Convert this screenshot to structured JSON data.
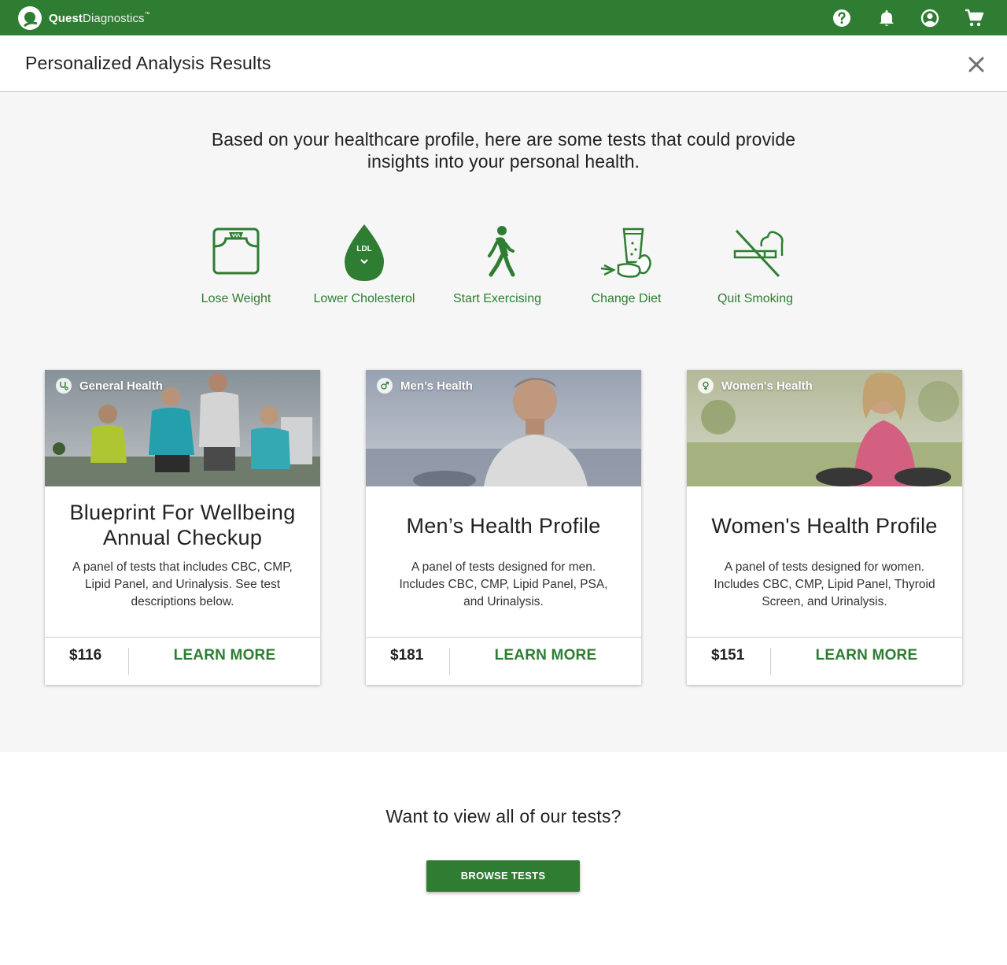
{
  "app": {
    "brand_bold": "Quest",
    "brand_light": "Diagnostics",
    "brand_tm": "™",
    "nav_icons": [
      "help-icon",
      "bell-icon",
      "account-icon",
      "cart-icon"
    ],
    "accent_color": "#2e7d32"
  },
  "header": {
    "title": "Personalized Analysis Results"
  },
  "intro": {
    "line1": "Based on your healthcare profile, here are some tests that could provide",
    "line2": "insights into your personal health."
  },
  "goals": [
    {
      "label": "Lose Weight",
      "icon": "scale-icon"
    },
    {
      "label": "Lower Cholesterol",
      "icon": "ldl-drop-icon",
      "icon_text": "LDL"
    },
    {
      "label": "Start Exercising",
      "icon": "walking-person-icon"
    },
    {
      "label": "Change Diet",
      "icon": "diet-icon"
    },
    {
      "label": "Quit Smoking",
      "icon": "no-smoking-icon"
    }
  ],
  "cards": [
    {
      "tag": "General Health",
      "title_line1": "Blueprint For Wellbeing",
      "title_line2": "Annual Checkup",
      "desc_line1": "A panel of tests that includes CBC, CMP,",
      "desc_line2": "Lipid Panel, and Urinalysis. See test",
      "desc_line3": "descriptions below.",
      "price": "$116",
      "cta": "LEARN MORE"
    },
    {
      "tag": "Men’s Health",
      "title_line1": "Men’s Health Profile",
      "desc_line1": "A panel of tests designed for men.",
      "desc_line2": "Includes CBC, CMP, Lipid Panel, PSA,",
      "desc_line3": "and Urinalysis.",
      "price": "$181",
      "cta": "LEARN MORE"
    },
    {
      "tag": "Women's Health",
      "title_line1": "Women's Health Profile",
      "desc_line1": "A panel of tests designed for women.",
      "desc_line2": "Includes CBC, CMP, Lipid Panel, Thyroid",
      "desc_line3": "Screen, and Urinalysis.",
      "price": "$151",
      "cta": "LEARN MORE"
    }
  ],
  "footer": {
    "question": "Want to view all of our tests?",
    "button": "BROWSE TESTS"
  }
}
